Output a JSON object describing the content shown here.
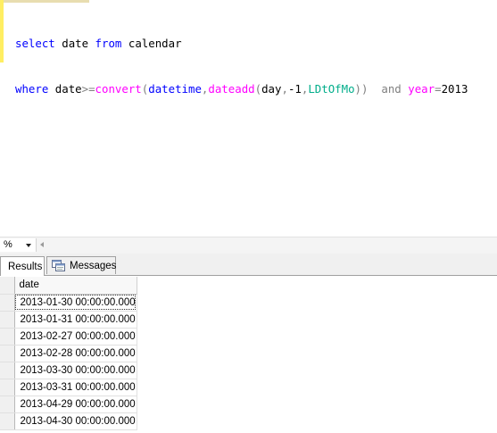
{
  "editor": {
    "line1": {
      "select": "select",
      "date": "date",
      "from": "from",
      "calendar": "calendar"
    },
    "line2": {
      "where": "where",
      "date": "date",
      "ge": ">=",
      "convert": "convert",
      "paren_open": "(",
      "datetime": "datetime",
      "comma1": ",",
      "dateadd": "dateadd",
      "paren_open2": "(",
      "day": "day",
      "comma2": ",",
      "minus1": "-1",
      "comma3": ",",
      "ldtofmo": "LDtOfMo",
      "paren_close": "))",
      "and": "and",
      "year": "year",
      "eq": "=",
      "yearval": "2013"
    }
  },
  "zoom": {
    "value": "%"
  },
  "tabs": {
    "results": "Results",
    "messages": "Messages"
  },
  "grid": {
    "column_header": "date",
    "rows": [
      "2013-01-30 00:00:00.000",
      "2013-01-31 00:00:00.000",
      "2013-02-27 00:00:00.000",
      "2013-02-28 00:00:00.000",
      "2013-03-30 00:00:00.000",
      "2013-03-31 00:00:00.000",
      "2013-04-29 00:00:00.000",
      "2013-04-30 00:00:00.000"
    ]
  },
  "colors": {
    "keyword": "#0000ff",
    "function": "#ff00ff",
    "operator": "#808080",
    "column": "#00ad8a",
    "gutter": "#ffee62"
  },
  "icons": {
    "messages_tab": "messages-icon",
    "zoom_dropdown": "chevron-down-icon",
    "scroll": "scroll-left-icon"
  }
}
